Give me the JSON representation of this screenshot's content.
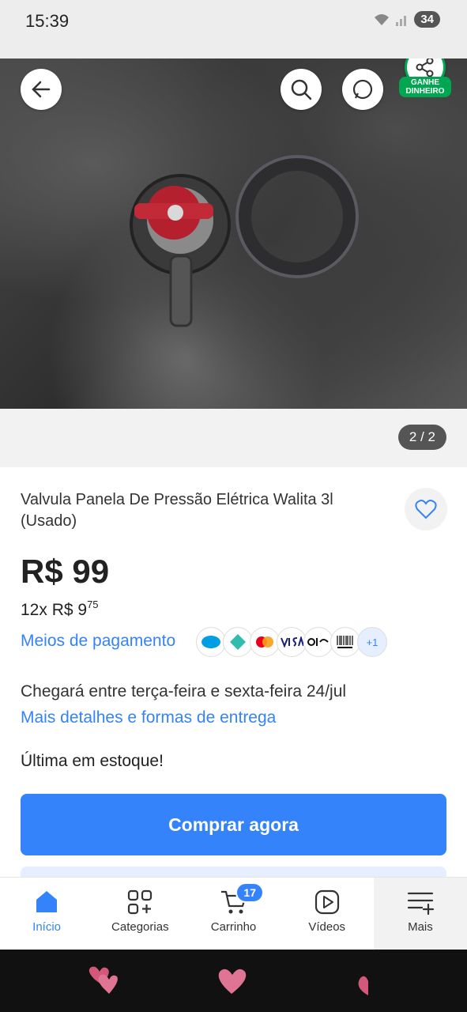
{
  "status_bar": {
    "time": "15:39",
    "battery": "34"
  },
  "hero": {
    "overlay_badge": "GANHE DINHEIRO",
    "counter": "2 / 2"
  },
  "product": {
    "title": "Valvula Panela De Pressão Elétrica Walita 3l (Usado)",
    "price": "R$ 99",
    "installments_prefix": "12x R$ 9",
    "installments_cents": "75",
    "payment_link": "Meios de pagamento",
    "payment_more": "+1",
    "delivery_text": "Chegará entre terça-feira e sexta-feira 24/jul",
    "delivery_link": "Mais detalhes e formas de entrega",
    "stock": "Última em estoque!",
    "buy_label": "Comprar agora"
  },
  "nav": {
    "home": "Início",
    "categories": "Categorias",
    "cart": "Carrinho",
    "cart_count": "17",
    "videos": "Vídeos",
    "more": "Mais"
  },
  "colors": {
    "accent": "#3483fa",
    "green": "#00a650"
  }
}
